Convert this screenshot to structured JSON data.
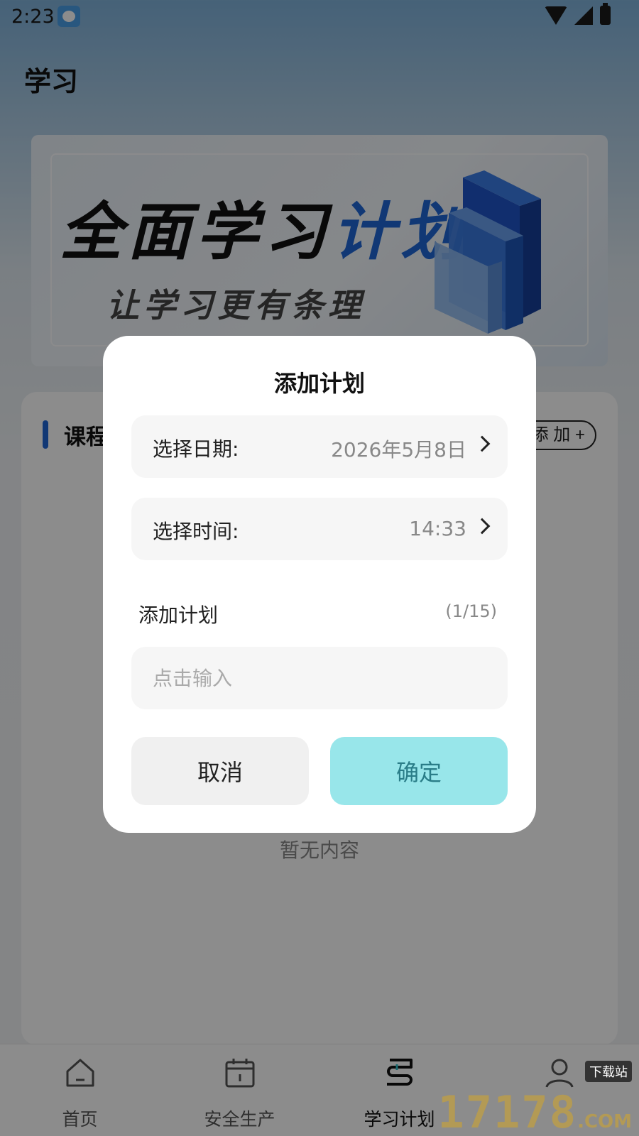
{
  "status_bar": {
    "time": "2:23"
  },
  "page": {
    "title": "学习"
  },
  "banner": {
    "headline_main": "全面学习",
    "headline_accent": "计划",
    "subheadline": "让学习更有条理"
  },
  "course_section": {
    "title": "课程",
    "add_label": "添 加 +",
    "empty_text": "暂无内容"
  },
  "dialog": {
    "title": "添加计划",
    "date_label": "选择日期:",
    "date_value": "2026年5月8日",
    "time_label": "选择时间:",
    "time_value": "14:33",
    "plan_label": "添加计划",
    "plan_count": "(1/15)",
    "plan_input_placeholder": "点击输入",
    "cancel_label": "取消",
    "confirm_label": "确定"
  },
  "tab_bar": {
    "tabs": [
      {
        "label": "首页",
        "icon": "home-icon"
      },
      {
        "label": "安全生产",
        "icon": "calendar-icon"
      },
      {
        "label": "学习计划",
        "icon": "plan-icon",
        "active": true
      },
      {
        "label": "",
        "icon": "profile-icon"
      }
    ]
  },
  "watermark": {
    "digits": "17178",
    "suffix": ".COM",
    "tag": "下载站"
  },
  "colors": {
    "accent_blue": "#1f67d6",
    "confirm_bg": "#98e6ea",
    "confirm_text": "#2a7d88"
  }
}
